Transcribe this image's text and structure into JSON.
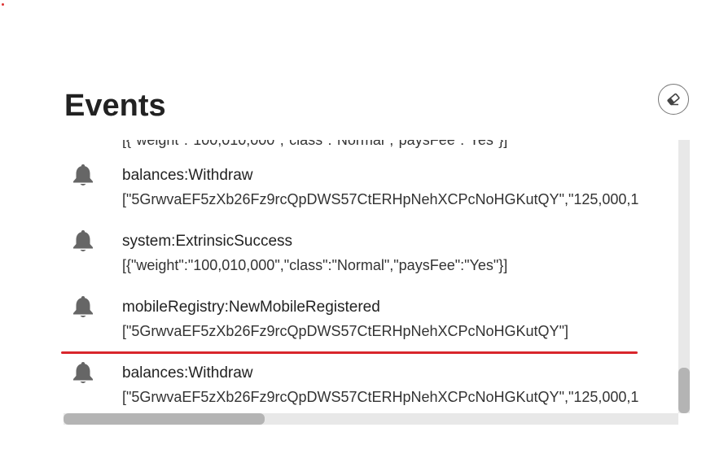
{
  "header": {
    "title": "Events"
  },
  "clear_button": {
    "icon": "eraser-icon"
  },
  "events": [
    {
      "name": "balances:Withdraw",
      "data": "[\"5GrwvaEF5zXb26Fz9rcQpDWS57CtERHpNehXCPcNoHGKutQY\",\"125,000,1",
      "icon": "bell-icon"
    },
    {
      "name": "system:ExtrinsicSuccess",
      "data": "[{\"weight\":\"100,010,000\",\"class\":\"Normal\",\"paysFee\":\"Yes\"}]",
      "icon": "bell-icon"
    },
    {
      "name": "mobileRegistry:NewMobileRegistered",
      "data": "[\"5GrwvaEF5zXb26Fz9rcQpDWS57CtERHpNehXCPcNoHGKutQY\"]",
      "icon": "bell-icon"
    },
    {
      "name": "balances:Withdraw",
      "data": "[\"5GrwvaEF5zXb26Fz9rcQpDWS57CtERHpNehXCPcNoHGKutQY\",\"125,000,1",
      "icon": "bell-icon"
    }
  ],
  "colors": {
    "accent_line": "#d9262c",
    "bell": "#666666"
  }
}
